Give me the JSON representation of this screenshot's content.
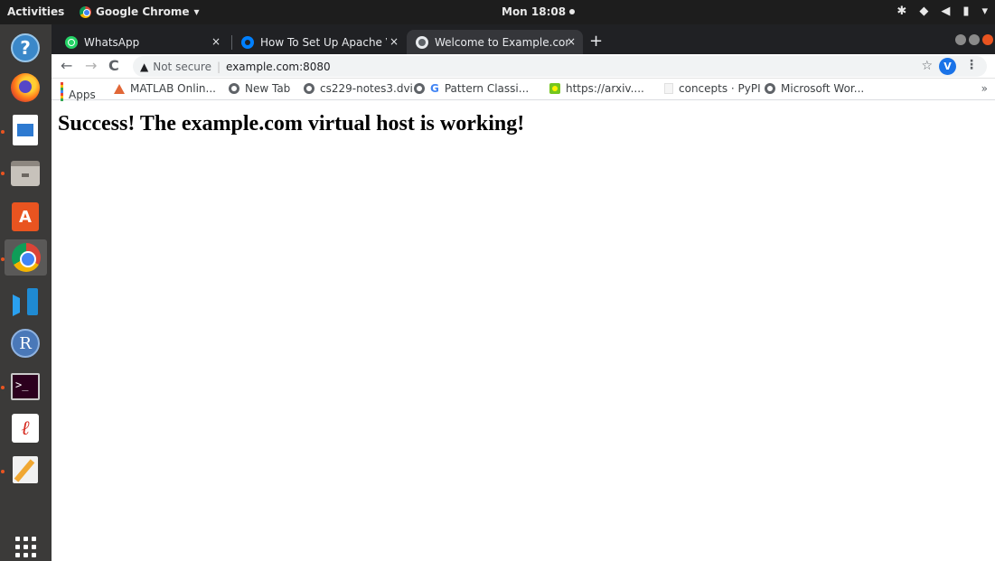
{
  "topbar": {
    "activities": "Activities",
    "app_name": "Google Chrome",
    "clock": "Mon 18:08"
  },
  "browser": {
    "tabs": [
      {
        "title": "WhatsApp",
        "close": "×"
      },
      {
        "title": "How To Set Up Apache Vi",
        "close": "×"
      },
      {
        "title": "Welcome to Example.com",
        "close": "×"
      }
    ],
    "new_tab": "+",
    "omnibox": {
      "security_label": "Not secure",
      "url": "example.com:8080"
    },
    "profile_initial": "V",
    "bookmarks": [
      {
        "label": "Apps"
      },
      {
        "label": "MATLAB Onlin..."
      },
      {
        "label": "New Tab"
      },
      {
        "label": "cs229-notes3.dvi"
      },
      {
        "label": "Pattern Classi..."
      },
      {
        "label": "https://arxiv...."
      },
      {
        "label": "concepts · PyPI"
      },
      {
        "label": "Microsoft Wor..."
      }
    ],
    "bookmarks_more": "»"
  },
  "page": {
    "heading": "Success! The example.com virtual host is working!"
  },
  "colors": {
    "ubuntu_orange": "#e95420",
    "chrome_tabstrip": "#202124",
    "dock_bg": "#3b3a39"
  }
}
